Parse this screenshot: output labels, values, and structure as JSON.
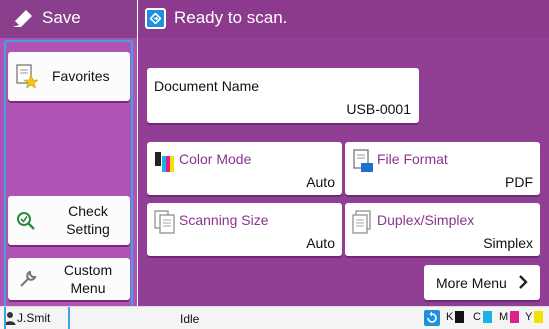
{
  "header": {
    "mode_title": "Save",
    "status_text": "Ready to scan."
  },
  "left_menu": {
    "favorites_label": "Favorites",
    "check_setting_label": "Check Setting",
    "custom_menu_label": "Custom Menu"
  },
  "document": {
    "name_label": "Document Name",
    "name_value": "USB-0001"
  },
  "settings": [
    {
      "label": "Color Mode",
      "value": "Auto",
      "icon": "color-mode-icon"
    },
    {
      "label": "File Format",
      "value": "PDF",
      "icon": "pdf-file-icon"
    },
    {
      "label": "Scanning Size",
      "value": "Auto",
      "icon": "scanning-size-icon"
    },
    {
      "label": "Duplex/Simplex",
      "value": "Simplex",
      "icon": "duplex-simplex-icon"
    }
  ],
  "more_menu_label": "More Menu",
  "status_bar": {
    "user": "J.Smit",
    "state": "Idle",
    "ink_labels": [
      "K",
      "C",
      "M",
      "Y"
    ]
  },
  "colors": {
    "header": "#8c3a8e",
    "left_panel": "#b152b5",
    "main_panel": "#913f94",
    "accent_blue": "#1f8fe0",
    "selection_frame": "#3ca5e6",
    "ink_k": "#111111",
    "ink_c": "#1ab0e8",
    "ink_m": "#e0208a",
    "ink_y": "#f2e200"
  }
}
